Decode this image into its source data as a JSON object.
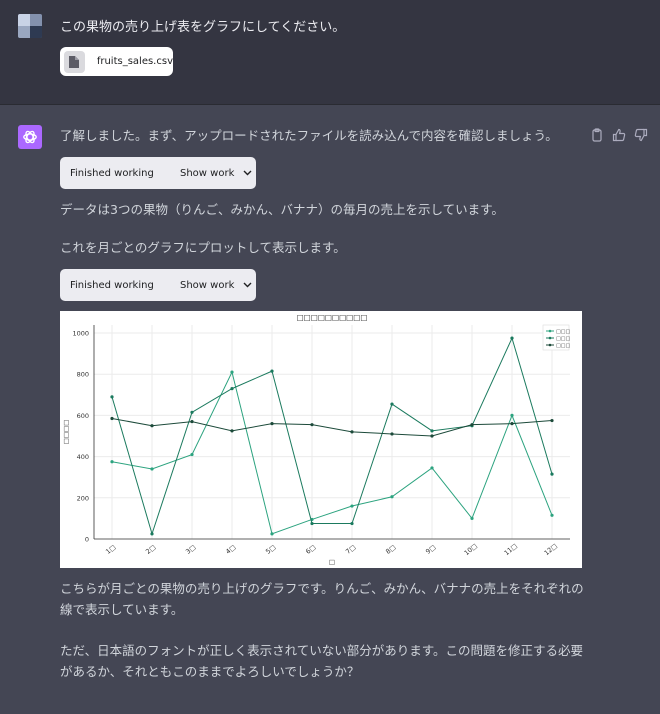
{
  "user_message": {
    "text": "この果物の売り上げ表をグラフにしてください。",
    "attachment": {
      "filename": "fruits_sales.csv",
      "icon": "file-icon"
    }
  },
  "assistant": {
    "intro": "了解しました。まず、アップロードされたファイルを読み込んで内容を確認しましょう。",
    "work_status_1": "Finished working",
    "show_work_1": "Show work",
    "data_desc": "データは3つの果物（りんご、みかん、バナナ）の毎月の売上を示しています。",
    "plot_desc": "これを月ごとのグラフにプロットして表示します。",
    "work_status_2": "Finished working",
    "show_work_2": "Show work",
    "result_desc": "こちらが月ごとの果物の売り上げのグラフです。りんご、みかん、バナナの売上をそれぞれの線で表示しています。",
    "font_note": "ただ、日本語のフォントが正しく表示されていない部分があります。この問題を修正する必要があるか、それともこのままでよろしいでしょうか？",
    "actions": [
      "copy-icon",
      "thumbs-up-icon",
      "thumbs-down-icon"
    ]
  },
  "chart_data": {
    "type": "line",
    "title": "□□□□□□□□□□",
    "xlabel": "□",
    "ylabel": "□□□□",
    "categories": [
      "1□",
      "2□",
      "3□",
      "4□",
      "5□",
      "6□",
      "7□",
      "8□",
      "9□",
      "10□",
      "11□",
      "12□"
    ],
    "ylim": [
      0,
      1000
    ],
    "yticks": [
      0,
      200,
      400,
      600,
      800,
      1000
    ],
    "grid": true,
    "legend_position": "top-right",
    "series": [
      {
        "name": "□□□",
        "color": "#2ca37f",
        "values": [
          375,
          340,
          410,
          810,
          25,
          95,
          160,
          205,
          345,
          100,
          600,
          115
        ]
      },
      {
        "name": "□□□",
        "color": "#1b7a5e",
        "values": [
          690,
          25,
          615,
          730,
          815,
          75,
          75,
          655,
          525,
          550,
          975,
          315
        ]
      },
      {
        "name": "□□□",
        "color": "#1c4a3a",
        "values": [
          585,
          550,
          570,
          525,
          560,
          555,
          520,
          510,
          500,
          555,
          560,
          575
        ]
      }
    ]
  }
}
